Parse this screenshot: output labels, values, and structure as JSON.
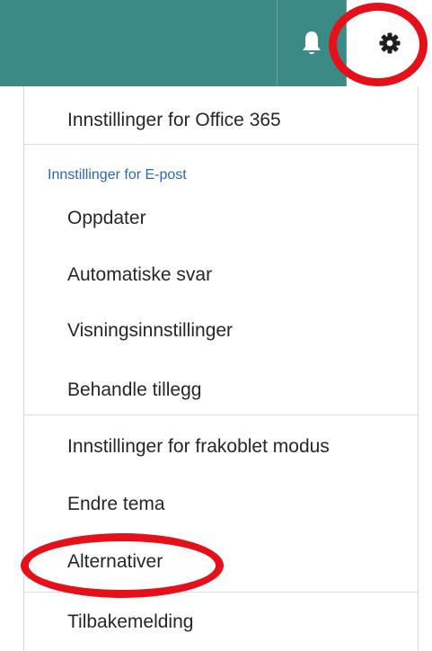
{
  "topbar": {
    "background_color": "#3b8a86",
    "icons": {
      "notifications": "bell-icon",
      "settings": "gear-icon"
    }
  },
  "settings_menu": {
    "office365_settings": "Innstillinger for Office 365",
    "mail_settings_header": "Innstillinger for E-post",
    "mail_items": [
      "Oppdater",
      "Automatiske svar",
      "Visningsinnstillinger",
      "Behandle tillegg"
    ],
    "other_items": [
      "Innstillinger for frakoblet modus",
      "Endre tema",
      "Alternativer"
    ],
    "feedback": "Tilbakemelding",
    "header_color": "#2a68b4"
  },
  "annotations": {
    "highlight_color": "#e5101a"
  }
}
